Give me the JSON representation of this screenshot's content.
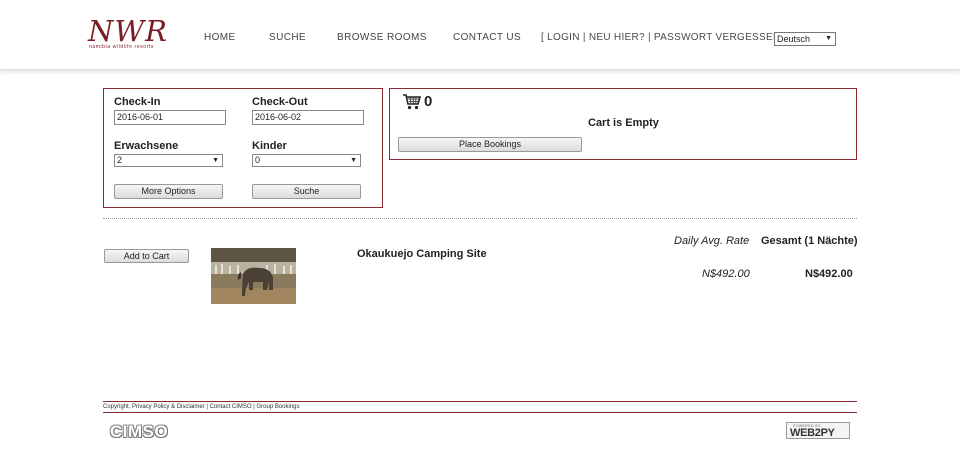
{
  "header": {
    "logo_text": "NWR",
    "logo_subtitle": "namibia wildlife resorts",
    "nav": [
      "HOME",
      "SUCHE",
      "BROWSE ROOMS",
      "CONTACT US"
    ],
    "auth_links": "[ LOGIN | NEU HIER? | PASSWORT VERGESSEN? ]",
    "language": "Deutsch"
  },
  "search": {
    "checkin_label": "Check-In",
    "checkin_value": "2016-06-01",
    "checkout_label": "Check-Out",
    "checkout_value": "2016-06-02",
    "adults_label": "Erwachsene",
    "adults_value": "2",
    "children_label": "Kinder",
    "children_value": "0",
    "more_options_label": "More Options",
    "search_label": "Suche"
  },
  "cart": {
    "icon": "shopping-cart-icon",
    "count": "0",
    "status": "Cart is Empty",
    "place_bookings_label": "Place Bookings"
  },
  "results": {
    "rate_header": "Daily Avg. Rate",
    "total_header": "Gesamt (1 Nächte)",
    "items": [
      {
        "add_label": "Add to Cart",
        "name": "Okaukuejo Camping Site",
        "daily_rate": "N$492.00",
        "total": "N$492.00"
      }
    ]
  },
  "footer": {
    "links": "Copyright, Privacy Policy & Disclaimer | Contact CIMSO | Group Bookings",
    "cimso_logo": "CIMSO",
    "web2py_top": "POWERED BY",
    "web2py_logo": "WEB2PY"
  },
  "colors": {
    "brand": "#7a1d24",
    "border": "#8b2a32"
  }
}
